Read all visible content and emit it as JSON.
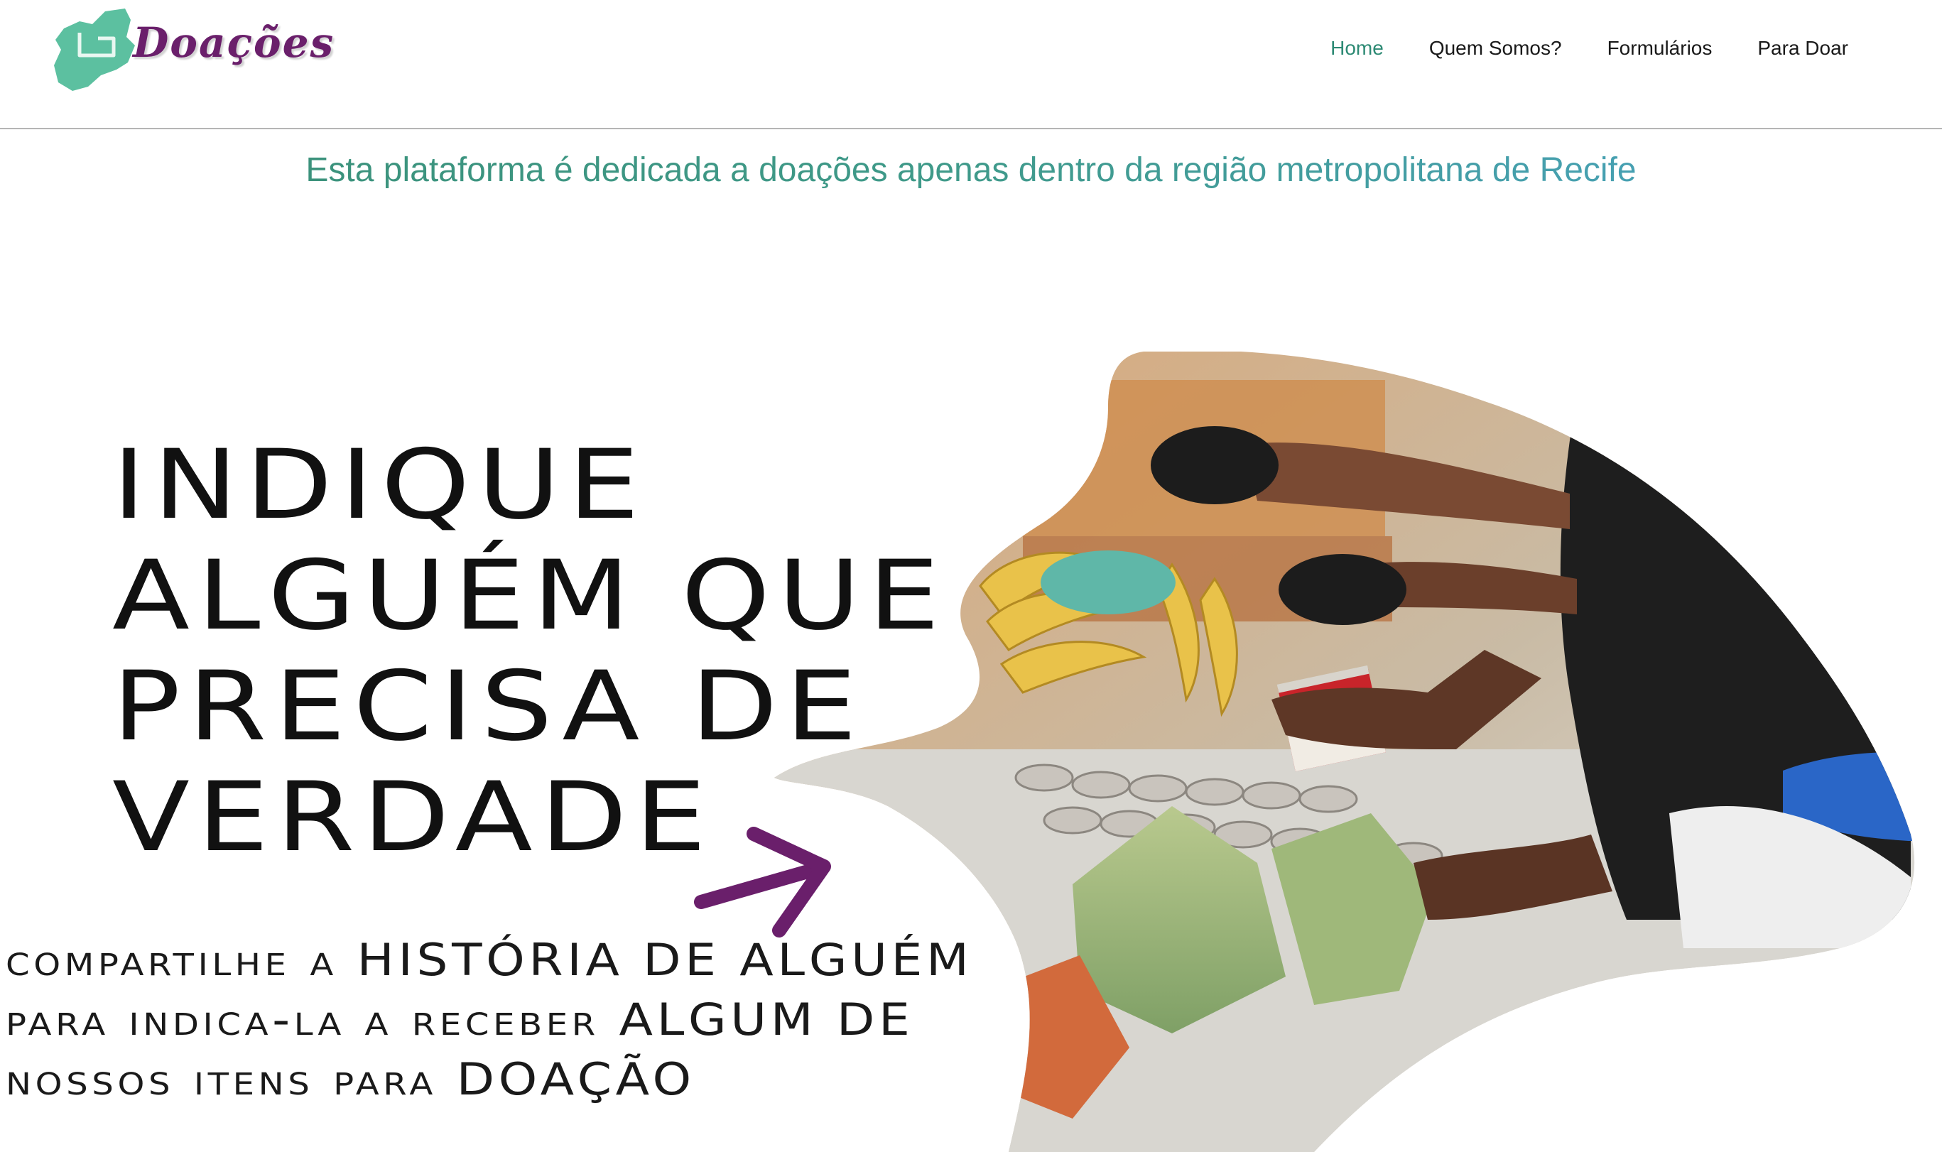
{
  "brand": {
    "name": "Doações",
    "accent_color": "#6a1f6b",
    "logo_color": "#5cc0a0"
  },
  "nav": {
    "items": [
      {
        "label": "Home",
        "active": true
      },
      {
        "label": "Quem Somos?",
        "active": false
      },
      {
        "label": "Formulários",
        "active": false
      },
      {
        "label": "Para Doar",
        "active": false
      }
    ],
    "active_color": "#2d8a74"
  },
  "notice": {
    "text": "Esta plataforma é dedicada a doações apenas dentro da região metropolitana de Recife"
  },
  "hero": {
    "headline_lines": [
      "INDIQUE",
      "ALGUÉM QUE",
      "PRECISA DE",
      "VERDADE"
    ],
    "subtext_lines": [
      "compartilhe a HISTÓRIA DE ALGUÉM",
      "para indica-la a receber ALGUM DE",
      "nossos itens para DOAÇÃO"
    ],
    "arrow_color": "#6a1f6b",
    "image_icon": "food-donation-photo"
  }
}
